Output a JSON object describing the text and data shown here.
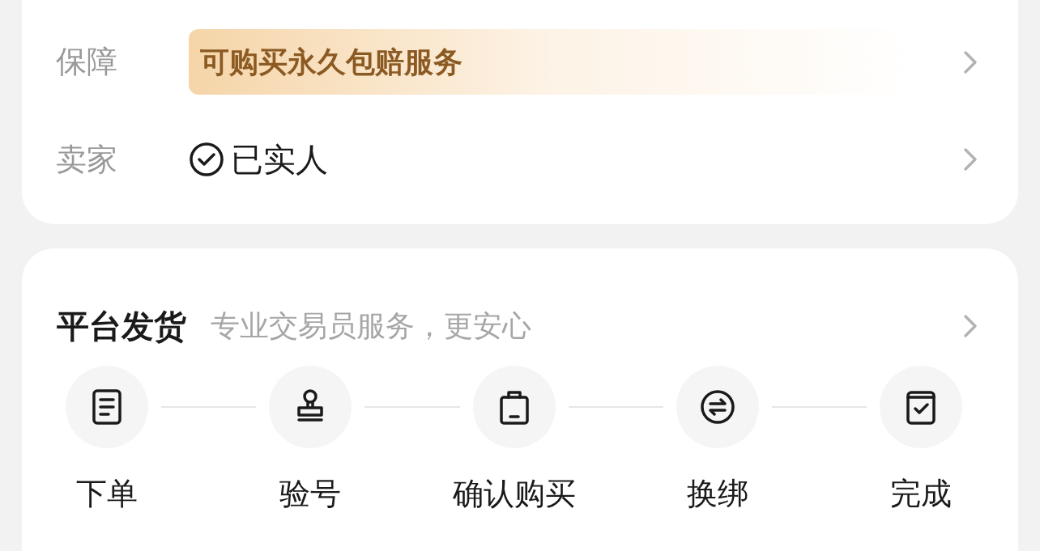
{
  "guarantee": {
    "label": "保障",
    "value": "可购买永久包赔服务"
  },
  "seller": {
    "label": "卖家",
    "value": "已实人",
    "verified": true
  },
  "delivery": {
    "title": "平台发货",
    "subtitle": "专业交易员服务，更安心"
  },
  "steps": [
    {
      "kind": "order",
      "label": "下单"
    },
    {
      "kind": "inspect",
      "label": "验号"
    },
    {
      "kind": "confirm",
      "label": "确认购买"
    },
    {
      "kind": "rebind",
      "label": "换绑"
    },
    {
      "kind": "done",
      "label": "完成"
    }
  ]
}
